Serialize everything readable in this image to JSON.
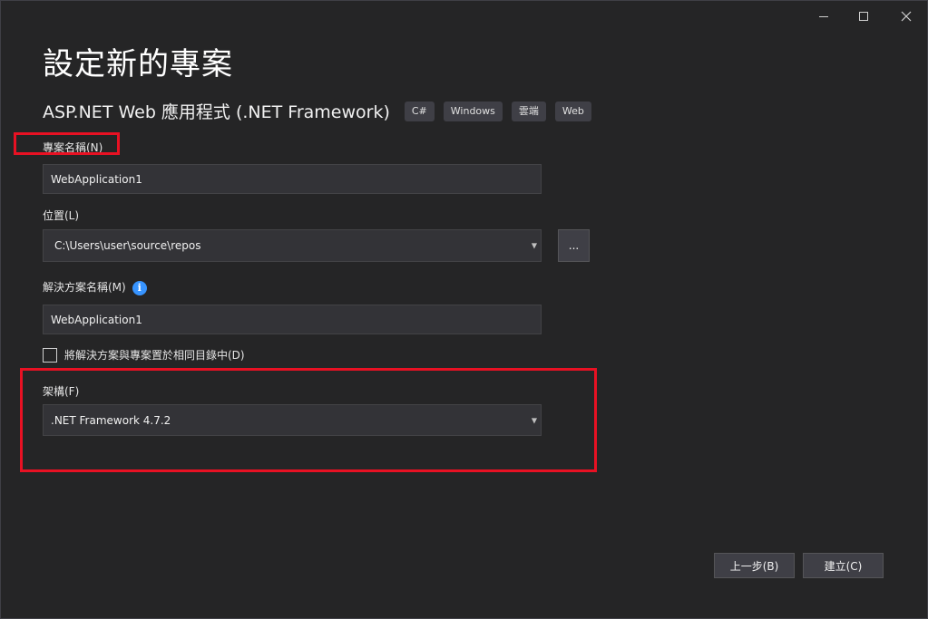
{
  "page_title": "設定新的專案",
  "template": {
    "name": "ASP.NET Web 應用程式 (.NET Framework)",
    "tags": [
      "C#",
      "Windows",
      "雲端",
      "Web"
    ]
  },
  "project_name": {
    "label": "專案名稱(N)",
    "value": "WebApplication1"
  },
  "location": {
    "label": "位置(L)",
    "value": "C:\\Users\\user\\source\\repos",
    "browse_label": "..."
  },
  "solution_name": {
    "label": "解決方案名稱(M)",
    "info_glyph": "i",
    "value": "WebApplication1"
  },
  "same_directory": {
    "label": "將解決方案與專案置於相同目錄中(D)",
    "checked": false
  },
  "framework": {
    "label": "架構(F)",
    "value": ".NET Framework 4.7.2"
  },
  "buttons": {
    "back": "上一步(B)",
    "create": "建立(C)"
  },
  "colors": {
    "background": "#252526",
    "input_bg": "#333337",
    "highlight": "#e81123",
    "info": "#3794ff"
  }
}
